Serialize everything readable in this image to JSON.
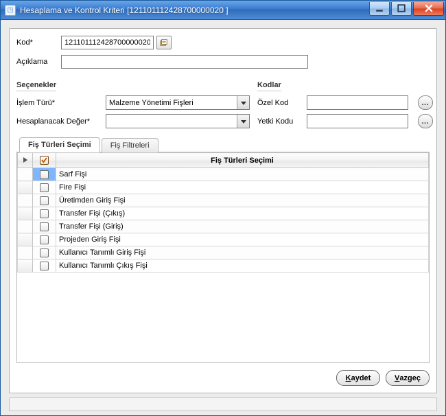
{
  "window": {
    "title": "Hesaplama ve Kontrol Kriteri [121101112428700000020 ]"
  },
  "form": {
    "kod_label": "Kod*",
    "kod_value": "121101112428700000020",
    "aciklama_label": "Açıklama",
    "aciklama_value": ""
  },
  "groups": {
    "secenekler_title": "Seçenekler",
    "kodlar_title": "Kodlar",
    "islem_turu_label": "İşlem Türü*",
    "islem_turu_value": "Malzeme Yönetimi Fişleri",
    "hesap_deger_label": "Hesaplanacak Değer*",
    "hesap_deger_value": "",
    "ozel_kod_label": "Özel Kod",
    "ozel_kod_value": "",
    "yetki_kodu_label": "Yetki Kodu",
    "yetki_kodu_value": ""
  },
  "tabs": {
    "t1": "Fiş Türleri Seçimi",
    "t2": "Fiş Filtreleri"
  },
  "table": {
    "header": "Fiş Türleri Seçimi",
    "rows": [
      {
        "label": "Sarf Fişi"
      },
      {
        "label": "Fire Fişi"
      },
      {
        "label": "Üretimden Giriş Fişi"
      },
      {
        "label": "Transfer Fişi (Çıkış)"
      },
      {
        "label": "Transfer Fişi (Giriş)"
      },
      {
        "label": "Projeden Giriş Fişi"
      },
      {
        "label": "Kullanıcı Tanımlı Giriş Fişi"
      },
      {
        "label": "Kullanıcı Tanımlı Çıkış Fişi"
      }
    ]
  },
  "buttons": {
    "kaydet": "Kaydet",
    "vazgec": "Vazgeç"
  }
}
